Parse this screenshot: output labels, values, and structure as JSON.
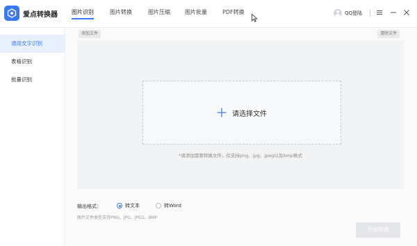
{
  "app": {
    "name": "爱点转换器",
    "brand_color": "#3a78f2"
  },
  "nav": {
    "tabs": [
      {
        "label": "图片识别",
        "active": true
      },
      {
        "label": "图片转换",
        "active": false
      },
      {
        "label": "图片压缩",
        "active": false
      },
      {
        "label": "图片批量",
        "active": false
      },
      {
        "label": "PDF转换",
        "active": false
      }
    ]
  },
  "user": {
    "label": "QQ登陆"
  },
  "window_controls": {
    "icons": [
      "menu-icon",
      "minimize-icon",
      "close-icon"
    ]
  },
  "sidebar": {
    "items": [
      {
        "label": "通用文字识别",
        "active": true
      },
      {
        "label": "表格识别",
        "active": false
      },
      {
        "label": "批量识别",
        "active": false
      }
    ]
  },
  "main": {
    "add_file_label": "添加文件",
    "clear_file_label": "清除文件",
    "choose_file_label": "请选择文件",
    "hint": "*请添加需要转换文件，仅支持png、jpg、jpeg以及bmp格式",
    "output_format_label": "输出格式：",
    "options": [
      {
        "label": "转文本",
        "checked": true
      },
      {
        "label": "转Word",
        "checked": false
      }
    ],
    "supported_formats": "图片文件类型支持PNG、JPG、JPEG、BMP",
    "start_label": "开始转换"
  }
}
